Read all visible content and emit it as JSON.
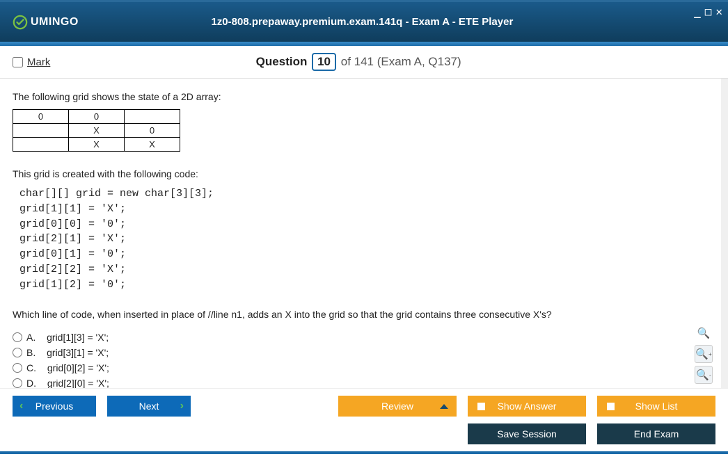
{
  "window": {
    "title": "1z0-808.prepaway.premium.exam.141q - Exam A - ETE Player",
    "logo_text": "UMINGO"
  },
  "header": {
    "mark_label": "Mark",
    "question_label": "Question",
    "question_num": "10",
    "question_total": "of 141 (Exam A, Q137)"
  },
  "question": {
    "intro1": "The following grid shows the state of a 2D array:",
    "grid": [
      [
        "0",
        "0",
        ""
      ],
      [
        "",
        "X",
        "0"
      ],
      [
        "",
        "X",
        "X"
      ]
    ],
    "intro2": "This grid is created with the following code:",
    "code": "char[][] grid = new char[3][3];\ngrid[1][1] = 'X';\ngrid[0][0] = '0';\ngrid[2][1] = 'X';\ngrid[0][1] = '0';\ngrid[2][2] = 'X';\ngrid[1][2] = '0';",
    "prompt": "Which line of code, when inserted in place of //line n1, adds an X into the grid so that the grid contains three consecutive X's?",
    "answers": [
      {
        "letter": "A.",
        "text": "grid[1][3] = 'X';"
      },
      {
        "letter": "B.",
        "text": "grid[3][1] = 'X';"
      },
      {
        "letter": "C.",
        "text": "grid[0][2] = 'X';"
      },
      {
        "letter": "D.",
        "text": "grid[2][0] = 'X';"
      }
    ]
  },
  "footer": {
    "prev": "Previous",
    "next": "Next",
    "review": "Review",
    "show_answer": "Show Answer",
    "show_list": "Show List",
    "save_session": "Save Session",
    "end_exam": "End Exam"
  }
}
